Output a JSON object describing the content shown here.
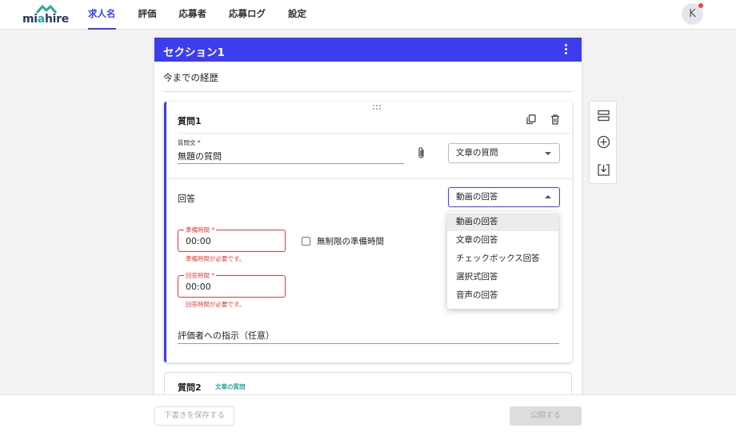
{
  "header": {
    "logo": {
      "prefix": "mi",
      "highlight": "a",
      "suffix": "hire"
    },
    "nav": [
      {
        "label": "求人名",
        "active": true
      },
      {
        "label": "評価",
        "active": false
      },
      {
        "label": "応募者",
        "active": false
      },
      {
        "label": "応募ログ",
        "active": false
      },
      {
        "label": "設定",
        "active": false
      }
    ],
    "avatar_initial": "K"
  },
  "section": {
    "title": "セクション1",
    "subtitle": "今までの経歴"
  },
  "question1": {
    "title": "質問1",
    "text_label": "質問文 *",
    "text_value": "無題の質問",
    "question_type": "文章の質問",
    "answer_label": "回答",
    "answer_type": "動画の回答",
    "prep_time": {
      "legend": "準備時間 *",
      "value": "00:00",
      "error": "準備時間が必要です。"
    },
    "unlimited_prep_label": "無制限の準備時間",
    "answer_time": {
      "legend": "回答時間 *",
      "value": "00:00",
      "error": "回答時間が必要です。"
    },
    "instruction_placeholder": "評価者への指示（任意）"
  },
  "answer_menu": {
    "options": [
      "動画の回答",
      "文章の回答",
      "チェックボックス回答",
      "選択式回答",
      "音声の回答"
    ],
    "selected": "動画の回答"
  },
  "question2": {
    "title": "質問2",
    "tag": "文章の質問"
  },
  "footer": {
    "save_draft": "下書きを保存する",
    "publish": "公開する"
  },
  "colors": {
    "accent": "#3d3df0",
    "error": "#e53935",
    "teal": "#2aa7a0"
  }
}
